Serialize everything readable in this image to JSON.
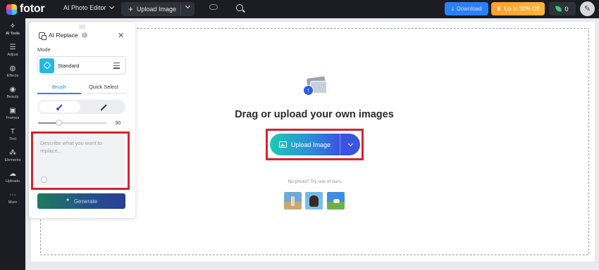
{
  "topbar": {
    "logo_text": "fotor",
    "app_menu_label": "AI Photo Editor",
    "upload_label": "Upload Image",
    "download_label": "Download",
    "discount_label": "Up to 30% Off",
    "credits": "0"
  },
  "rail": {
    "items": [
      {
        "label": "AI Tools",
        "icon": "wand-icon"
      },
      {
        "label": "Adjust",
        "icon": "sliders-icon"
      },
      {
        "label": "Effects",
        "icon": "effects-icon"
      },
      {
        "label": "Beauty",
        "icon": "eye-icon"
      },
      {
        "label": "Frames",
        "icon": "frame-icon"
      },
      {
        "label": "Text",
        "icon": "text-icon"
      },
      {
        "label": "Elements",
        "icon": "elements-icon"
      },
      {
        "label": "Uploads",
        "icon": "cloud-upload-icon"
      },
      {
        "label": "More",
        "icon": "more-icon"
      }
    ]
  },
  "panel": {
    "title": "AI Replace",
    "mode_label": "Mode",
    "mode_value": "Standard",
    "tabs": [
      {
        "label": "Brush",
        "active": true
      },
      {
        "label": "Quick Select",
        "active": false
      }
    ],
    "brush_size": 30,
    "brush_size_max": 100,
    "prompt_placeholder": "Describe what you want to replace...",
    "prompt_value": "",
    "generate_label": "Generate"
  },
  "canvas": {
    "headline": "Drag or upload your own images",
    "upload_button_label": "Upload Image",
    "sample_caption": "No photo? Try one of ours."
  },
  "colors": {
    "accent": "#2d7ff9",
    "highlight_outline": "#d4242f",
    "topbar_bg": "#1b1d22"
  }
}
